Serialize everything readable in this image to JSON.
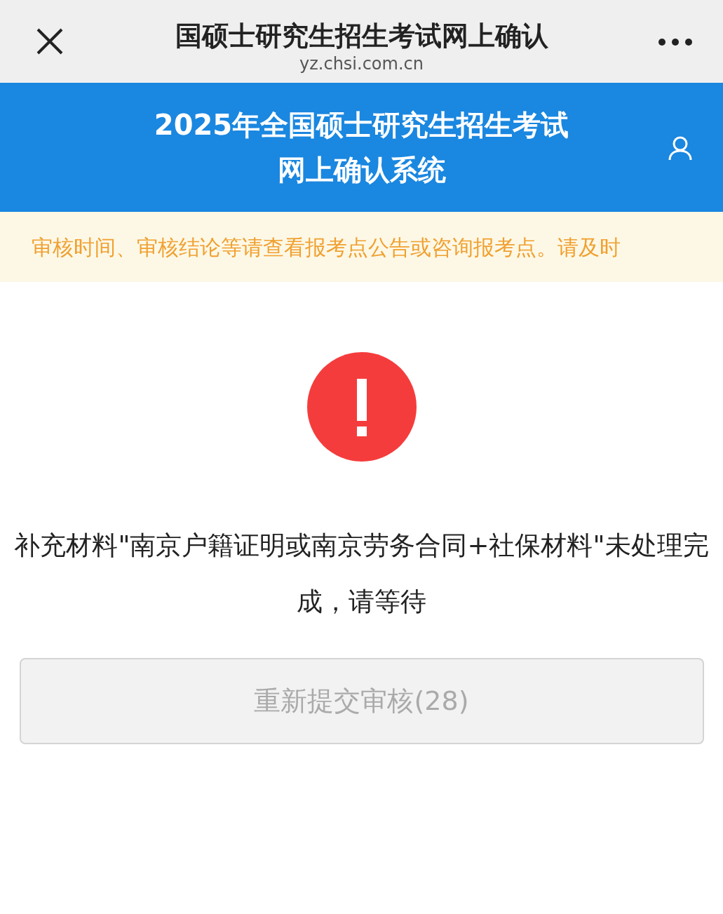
{
  "top_bar": {
    "title": "国硕士研究生招生考试网上确认",
    "url": "yz.chsi.com.cn"
  },
  "header": {
    "title_lines": [
      "2025年全国硕士研究生招生考试",
      "网上确认系统"
    ]
  },
  "notice": {
    "text": "审核时间、审核结论等请查看报考点公告或咨询报考点。请及时"
  },
  "status": {
    "kind": "warning",
    "message": "补充材料\"南京户籍证明或南京劳务合同+社保材料\"未处理完成，请等待"
  },
  "button": {
    "label": "重新提交审核(28)",
    "disabled": true
  }
}
